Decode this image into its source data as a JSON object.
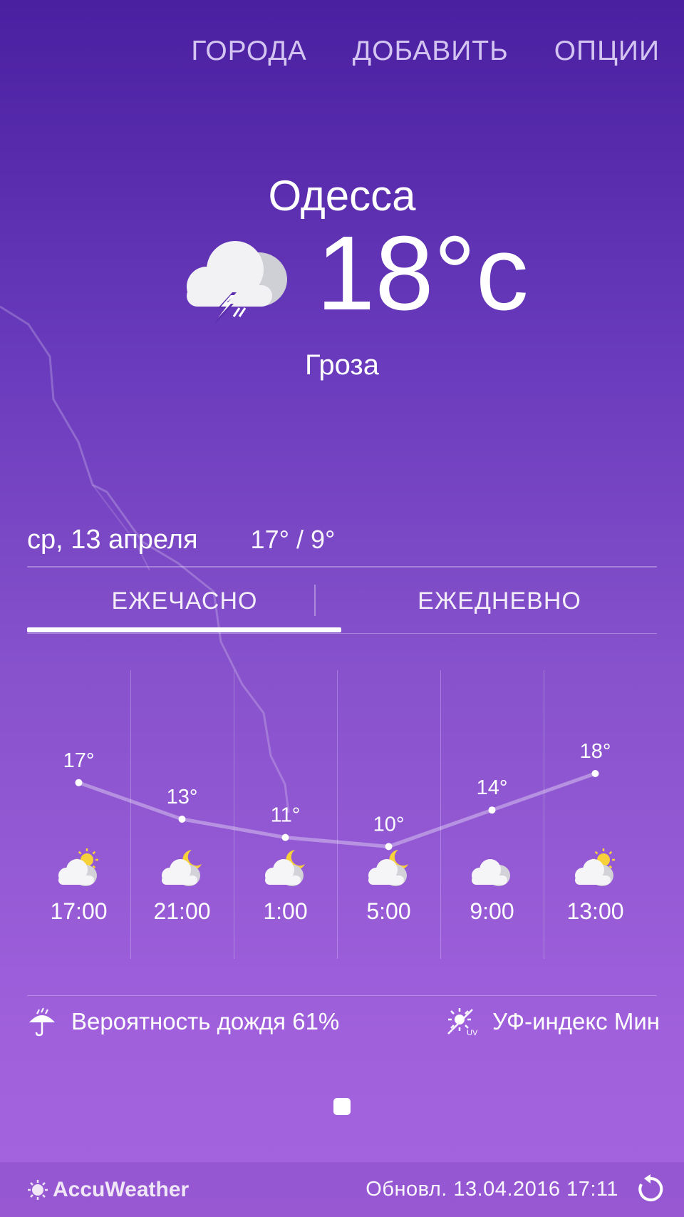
{
  "nav": {
    "cities": "ГОРОДА",
    "add": "ДОБАВИТЬ",
    "options": "ОПЦИИ"
  },
  "current": {
    "city": "Одесса",
    "temperature": "18°c",
    "condition": "Гроза",
    "icon": "thunderstorm-cloud-icon"
  },
  "today": {
    "date": "ср, 13 апреля",
    "hilo": "17° / 9°"
  },
  "tabs": {
    "hourly": "ЕЖЕЧАСНО",
    "daily": "ЕЖЕДНЕВНО",
    "active": "hourly"
  },
  "hourly": [
    {
      "time": "17:00",
      "temp": "17°",
      "icon": "partly-sunny-icon"
    },
    {
      "time": "21:00",
      "temp": "13°",
      "icon": "partly-cloudy-night-icon"
    },
    {
      "time": "1:00",
      "temp": "11°",
      "icon": "partly-cloudy-night-icon"
    },
    {
      "time": "5:00",
      "temp": "10°",
      "icon": "partly-cloudy-night-icon"
    },
    {
      "time": "9:00",
      "temp": "14°",
      "icon": "cloudy-icon"
    },
    {
      "time": "13:00",
      "temp": "18°",
      "icon": "partly-sunny-icon"
    }
  ],
  "chart_data": {
    "type": "line",
    "categories": [
      "17:00",
      "21:00",
      "1:00",
      "5:00",
      "9:00",
      "13:00"
    ],
    "values": [
      17,
      13,
      11,
      10,
      14,
      18
    ]
  },
  "info": {
    "rain": "Вероятность дождя 61%",
    "uv": "УФ-индекс Мин"
  },
  "footer": {
    "brand": "AccuWeather",
    "updated": "Обновл.  13.04.2016  17:11"
  }
}
